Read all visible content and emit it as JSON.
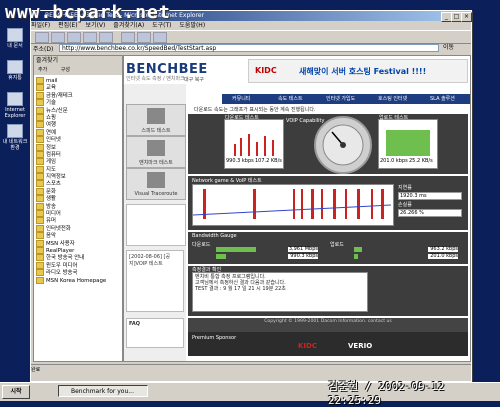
{
  "watermark": "www.bcpark.net",
  "desktop": {
    "icons": [
      "내 문서",
      "휴지통",
      "Internet Explorer",
      "내 네트워크 환경"
    ]
  },
  "window": {
    "title": "BENCHBEE :: Speed Test - Microsoft Internet Explorer",
    "minimize": "_",
    "maximize": "□",
    "close": "×",
    "menu": [
      "파일(F)",
      "편집(E)",
      "보기(V)",
      "즐겨찾기(A)",
      "도구(T)",
      "도움말(H)"
    ],
    "address_label": "주소(D)",
    "address": "http://www.benchbee.co.kr/SpeedBed/TestStart.asp",
    "go_label": "이동"
  },
  "favorites": {
    "header": "즐겨찾기",
    "add_label": "추가",
    "organize_label": "구성",
    "items": [
      "mail",
      "교육",
      "금융/재테크",
      "기술",
      "뉴스/신문",
      "쇼핑",
      "여행",
      "연예",
      "인터넷",
      "정보",
      "컴퓨터",
      "게임",
      "지도",
      "지역정보",
      "스포츠",
      "문화",
      "생활",
      "방송",
      "미디어",
      "유머",
      "인터넷전화",
      "음악",
      "MSN 사용자",
      "RealPlayer",
      "한국 방송국 안내",
      "윈도우 미디어",
      "라디오 방송국",
      "MSN Korea Homepage"
    ]
  },
  "page": {
    "logo": "BENCHBEE",
    "logo_sub": "인터넷 속도 측정 / 벤치마크",
    "login_text": "대구 북구",
    "banner_brand": "KIDC",
    "banner_text": "새해맞이 서버 호스팅 Festival !!!!",
    "nav": [
      "커뮤니티",
      "속도 테스트",
      "인터넷 가입도",
      "호스팅 인터넷",
      "SLA 솔루션"
    ],
    "left_nav": [
      "스피드 테스트",
      "벤치마크 테스트",
      "Visual Traceroute"
    ],
    "side_event": "[2002-08-06] [공지]VOIP 테스트",
    "faq": "FAQ",
    "subtitle": "다운로드 속도는 그래프가 표시되는 동안 계속 진행됩니다.",
    "download_label": "다운로드 테스트",
    "upload_label": "업로드 테스트",
    "download_speed": "990.3 kbps",
    "download_max": "107.2 KB/s",
    "voip_label": "VOIP Capability",
    "upload_speed": "201.0 kbps",
    "upload_max": "25.2 KB/s",
    "network_label": "Network game & VoIP 테스트",
    "latency_label": "지연률",
    "latency": "1920.3 ms",
    "loss_label": "손실률",
    "loss": "26.266 %",
    "bandwidth_label": "Bandwidth Gauge",
    "bw_download_label": "다운로드",
    "bw_upload_label": "업로드",
    "bw_d1": "3,961 Mbps",
    "bw_d2": "990.3 kbps",
    "bw_u1": "963.2 kbps",
    "bw_u2": "201.0 kbps",
    "msg_title": "측정결과 확인",
    "msg_lines": [
      "벤치비 통합 측정 프로그램입니다.",
      "고객님께서 측정하신 결과 다음과 같습니다.",
      "TEST 결과 :   9 월 17 일  21 시 19분 22초"
    ],
    "footer": "Copyright © 1999-2001 Dacom Information. contact us",
    "sponsor_label": "Premium Sponsor",
    "sponsor_brand": "KIDC",
    "sponsor_brand2": "VERIO"
  },
  "statusbar": "완료",
  "taskbar": {
    "start": "시작",
    "task": "Benchmark for you..."
  },
  "stamp": "김준현 / 2002-09-12 22:25:29",
  "colors": {
    "desktop": "#0b1f5a",
    "nav": "#1e3c80",
    "accent_red": "#cc2222",
    "graph_green": "#6fbf4f"
  }
}
